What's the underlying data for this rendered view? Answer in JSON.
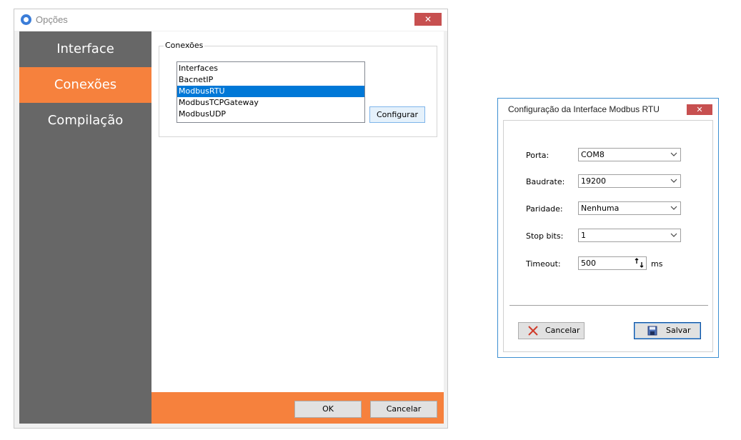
{
  "options_window": {
    "title": "Opções",
    "close_label": "✕",
    "sidebar": {
      "items": [
        {
          "label": "Interface",
          "active": false
        },
        {
          "label": "Conexões",
          "active": true
        },
        {
          "label": "Compilação",
          "active": false
        }
      ]
    },
    "connections": {
      "group_label": "Conexões",
      "list_items": [
        "Interfaces",
        "BacnetIP",
        "ModbusRTU",
        "ModbusTCPGateway",
        "ModbusUDP"
      ],
      "selected": "ModbusRTU",
      "configure_label": "Configurar"
    },
    "footer": {
      "ok_label": "OK",
      "cancel_label": "Cancelar"
    },
    "colors": {
      "accent": "#f6813d",
      "sidebar": "#676767",
      "selection": "#0078d7"
    }
  },
  "modbus_dialog": {
    "title": "Configuração da Interface Modbus RTU",
    "close_label": "✕",
    "fields": {
      "porta": {
        "label": "Porta:",
        "value": "COM8"
      },
      "baudrate": {
        "label": "Baudrate:",
        "value": "19200"
      },
      "paridade": {
        "label": "Paridade:",
        "value": "Nenhuma"
      },
      "stop_bits": {
        "label": "Stop bits:",
        "value": "1"
      },
      "timeout": {
        "label": "Timeout:",
        "value": "500",
        "units": "ms"
      }
    },
    "buttons": {
      "cancel_label": "Cancelar",
      "save_label": "Salvar"
    }
  }
}
